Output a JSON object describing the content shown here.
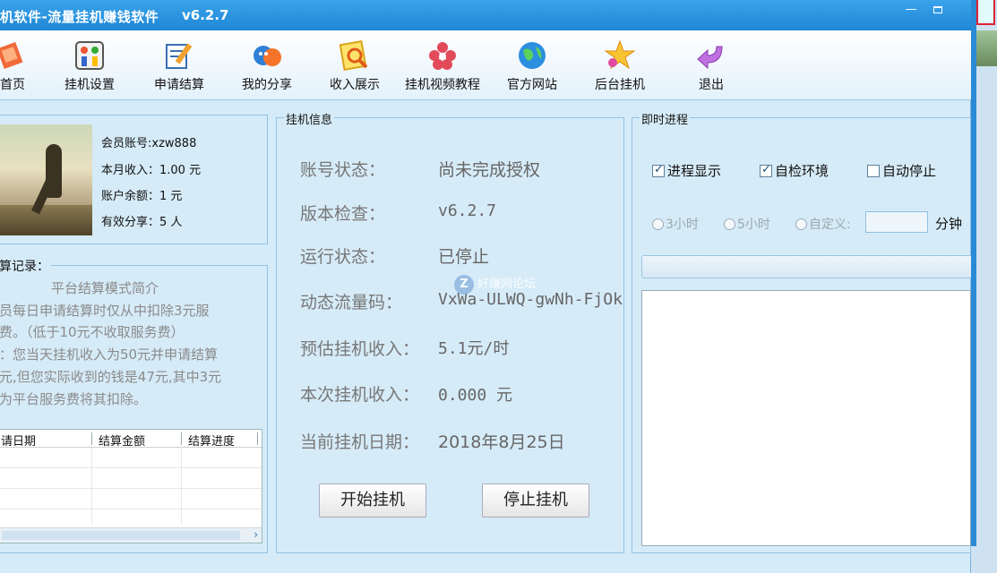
{
  "window": {
    "title": "机软件-流量挂机赚钱软件",
    "version": "v6.2.7",
    "min_symbol": "—",
    "max_symbol": ""
  },
  "toolbar": [
    {
      "label": "首页",
      "icon": "home-icon"
    },
    {
      "label": "挂机设置",
      "icon": "settings-icon"
    },
    {
      "label": "申请结算",
      "icon": "apply-settlement-icon"
    },
    {
      "label": "我的分享",
      "icon": "share-icon"
    },
    {
      "label": "收入展示",
      "icon": "income-icon"
    },
    {
      "label": "挂机视频教程",
      "icon": "video-tutorial-icon"
    },
    {
      "label": "官方网站",
      "icon": "globe-icon"
    },
    {
      "label": "后台挂机",
      "icon": "star-icon"
    },
    {
      "label": "退出",
      "icon": "exit-arrow-icon"
    }
  ],
  "profile": {
    "account": "会员账号:xzw888",
    "month_income": "本月收入：1.00 元",
    "balance": "账户余额：1 元",
    "shares": "有效分享：5 人"
  },
  "record": {
    "title": "算记录：",
    "lines": [
      "平台结算模式简介",
      "员每日申请结算时仅从中扣除3元服",
      "费。（低于10元不收取服务费）",
      "：您当天挂机收入为50元并申请结算",
      "元,但您实际收到的钱是47元,其中3元",
      "为平台服务费将其扣除。"
    ],
    "columns": [
      "请日期",
      "结算金额",
      "结算进度"
    ],
    "scroll_arrow": "›"
  },
  "info": {
    "title": "挂机信息",
    "rows": [
      {
        "label": "账号状态：",
        "value": "尚未完成授权"
      },
      {
        "label": "版本检查：",
        "value": "v6.2.7"
      },
      {
        "label": "运行状态：",
        "value": "已停止"
      },
      {
        "label": "动态流量码：",
        "value": "VxWa-ULWQ-gwNh-FjOk"
      },
      {
        "label": "预估挂机收入：",
        "value": "5.1元/时"
      },
      {
        "label": "本次挂机收入：",
        "value": "0.000 元"
      },
      {
        "label": "当前挂机日期：",
        "value": "2018年8月25日"
      }
    ],
    "start_label": "开始挂机",
    "stop_label": "停止挂机"
  },
  "progress": {
    "title": "即时进程",
    "checkboxes": [
      {
        "label": "进程显示",
        "checked": true
      },
      {
        "label": "自检环境",
        "checked": true
      },
      {
        "label": "自动停止",
        "checked": false
      }
    ],
    "radios": [
      "3小时",
      "5小时",
      "自定义:"
    ],
    "unit": "分钟"
  },
  "watermark": {
    "glyph": "Z",
    "text": "好赚网论坛"
  }
}
